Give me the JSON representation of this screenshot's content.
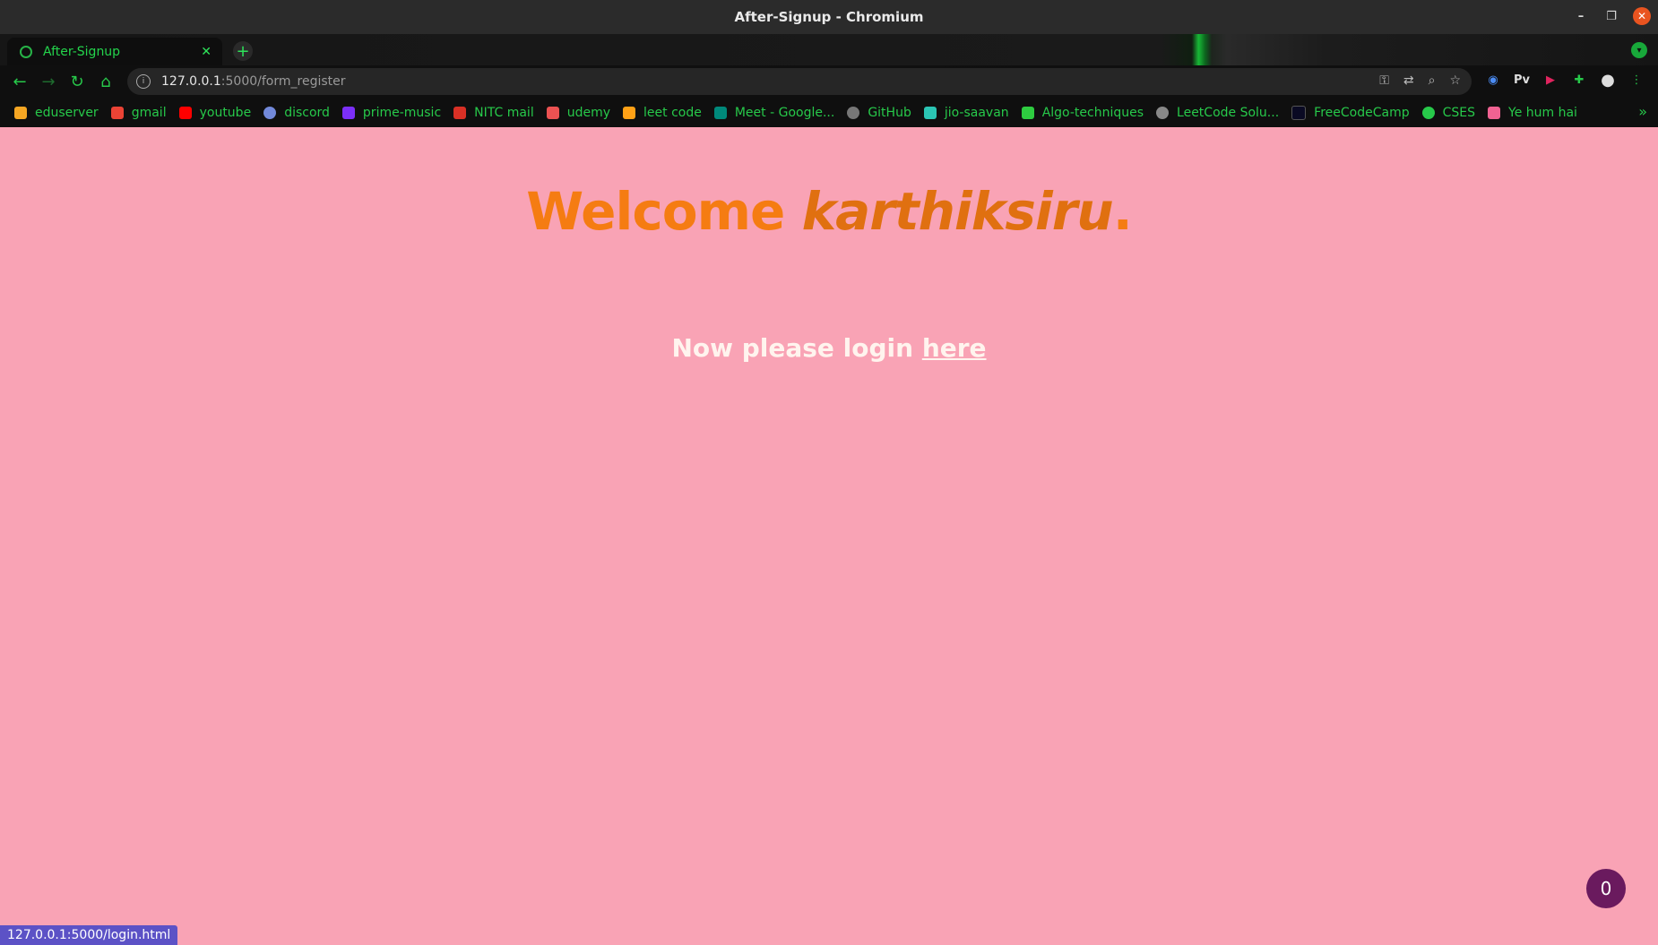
{
  "window": {
    "title": "After-Signup - Chromium"
  },
  "tab": {
    "title": "After-Signup"
  },
  "omnibox": {
    "host": "127.0.0.1",
    "rest": ":5000/form_register"
  },
  "bookmarks": [
    {
      "label": "eduserver",
      "color": "#f5a623"
    },
    {
      "label": "gmail",
      "color": "#ea4335"
    },
    {
      "label": "youtube",
      "color": "#ff0000"
    },
    {
      "label": "discord",
      "color": "#7289da"
    },
    {
      "label": "prime-music",
      "color": "#7b2ff7"
    },
    {
      "label": "NITC mail",
      "color": "#d93025"
    },
    {
      "label": "udemy",
      "color": "#ec5252"
    },
    {
      "label": "leet code",
      "color": "#ffa116"
    },
    {
      "label": "Meet - Google...",
      "color": "#00897b"
    },
    {
      "label": "GitHub",
      "color": "#777777"
    },
    {
      "label": "jio-saavan",
      "color": "#2bc5b4"
    },
    {
      "label": "Algo-techniques",
      "color": "#2ecc40"
    },
    {
      "label": "LeetCode Solu...",
      "color": "#888888"
    },
    {
      "label": "FreeCodeCamp",
      "color": "#0a0a23"
    },
    {
      "label": "CSES",
      "color": "#27c94a"
    },
    {
      "label": "Ye hum hai",
      "color": "#f06292"
    }
  ],
  "extensions": {
    "pv_label": "Pv",
    "badge_count": "0"
  },
  "page": {
    "welcome_prefix": "Welcome",
    "username": "karthiksiru",
    "username_suffix": ".",
    "login_text": "Now please login",
    "login_link": "here"
  },
  "floating_badge": "0",
  "status_url": "127.0.0.1:5000/login.html"
}
